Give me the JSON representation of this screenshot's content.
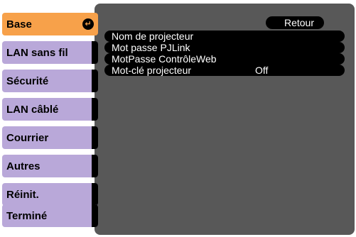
{
  "sidebar": {
    "items": [
      {
        "label": "Base",
        "selected": true
      },
      {
        "label": "LAN sans fil",
        "selected": false
      },
      {
        "label": "Sécurité",
        "selected": false
      },
      {
        "label": "LAN câblé",
        "selected": false
      },
      {
        "label": "Courrier",
        "selected": false
      },
      {
        "label": "Autres",
        "selected": false
      },
      {
        "label": "Réinit.",
        "selected": false
      },
      {
        "label": "Terminé",
        "selected": false
      }
    ],
    "selected_icon": "enter-icon"
  },
  "main": {
    "back_label": "Retour",
    "settings": [
      {
        "label": "Nom de projecteur",
        "value": ""
      },
      {
        "label": "Mot passe PJLink",
        "value": ""
      },
      {
        "label": "MotPasse ContrôleWeb",
        "value": ""
      },
      {
        "label": "Mot-clé projecteur",
        "value": "Off"
      }
    ]
  },
  "colors": {
    "panel": "#585858",
    "menu_item": "#b9a8d9",
    "menu_selected": "#f7a14a",
    "row_background": "#000000"
  }
}
